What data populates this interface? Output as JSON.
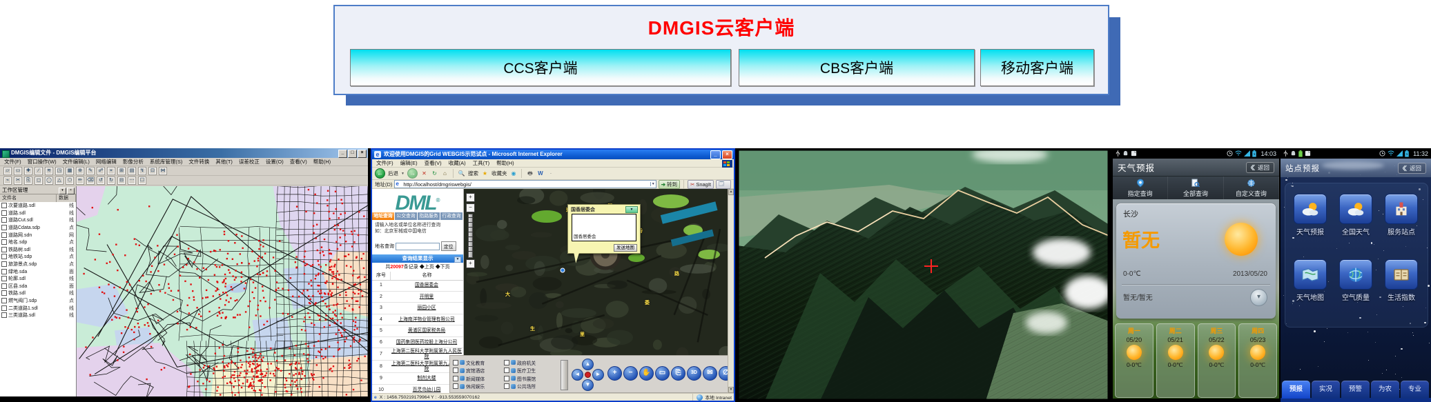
{
  "diagram": {
    "title": "DMGIS云客户端",
    "boxes": [
      {
        "label": "CCS客户端"
      },
      {
        "label": "CBS客户端"
      },
      {
        "label": "移动客户端"
      }
    ],
    "colors": {
      "border": "#4d7cc7",
      "shadow": "#3f6ab5",
      "title": "#ff0000",
      "box_gradient_top": "#00dff0"
    }
  },
  "gis": {
    "window_title": "DMGIS编辑文件 - DMGIS编辑平台",
    "menus": [
      "文件(F)",
      "窗口操作(W)",
      "文件编辑(L)",
      "网络编辑",
      "影像分析",
      "系统库管理(S)",
      "文件转换",
      "其他(T)",
      "误差校正",
      "设置(O)",
      "查看(V)",
      "帮助(H)"
    ],
    "panel_title": "工作区管理",
    "columns": [
      "文件名",
      "数据"
    ],
    "layers": [
      {
        "name": "次要道路.sdl",
        "type": "线"
      },
      {
        "name": "道路.sdl",
        "type": "线"
      },
      {
        "name": "道路Cut.sdl",
        "type": "线"
      },
      {
        "name": "道路Cdata.sdp",
        "type": "点"
      },
      {
        "name": "道路网.sdn",
        "type": "网"
      },
      {
        "name": "地名.sdp",
        "type": "点"
      },
      {
        "name": "铁路树.sdl",
        "type": "线"
      },
      {
        "name": "地铁站.sdp",
        "type": "点"
      },
      {
        "name": "旅游景点.sdp",
        "type": "点"
      },
      {
        "name": "绿地.sda",
        "type": "面"
      },
      {
        "name": "轮廓.sdl",
        "type": "线"
      },
      {
        "name": "区县.sda",
        "type": "面"
      },
      {
        "name": "铁路.sdl",
        "type": "线"
      },
      {
        "name": "燃气阀门.sdp",
        "type": "点"
      },
      {
        "name": "二类道路1.sdl",
        "type": "线"
      },
      {
        "name": "三类道路.sdl",
        "type": "线"
      }
    ]
  },
  "browser": {
    "window_title": "欢迎使用DMGIS的Grid WEBGIS示范试点 - Microsoft Internet Explorer",
    "menus": [
      "文件(F)",
      "编辑(E)",
      "查看(V)",
      "收藏(A)",
      "工具(T)",
      "帮助(H)"
    ],
    "toolbar": {
      "back": "后退",
      "search_label": "搜索",
      "favorites_label": "收藏夹"
    },
    "address": {
      "label": "地址(D)",
      "url": "http://localhost/dmgriswebgis/",
      "go": "转到",
      "snagit": "SnagIt"
    },
    "panel": {
      "logo": "DML",
      "tabs": [
        "地址查询",
        "公交查询",
        "指路服务",
        "行政查询"
      ],
      "hint_line1": "请输入地名或单位名称进行查询",
      "hint_line2": "如：北京军械或中国电信",
      "search_label": "地名查询",
      "locate_button": "定位",
      "results_title": "查询结果显示",
      "total_prefix": "共",
      "total_count": "20097",
      "total_suffix": "条记录",
      "page_prev": "◆上页",
      "page_next": "◆下页",
      "columns": [
        "序号",
        "名称"
      ],
      "rows": [
        {
          "no": "1",
          "name": "国香居委会"
        },
        {
          "no": "2",
          "name": "开明里"
        },
        {
          "no": "3",
          "name": "丽园小区"
        },
        {
          "no": "4",
          "name": "上海南洋物业管理有限公司"
        },
        {
          "no": "5",
          "name": "黄浦区国家税务局"
        },
        {
          "no": "6",
          "name": "国药集团医药控股上海分公司"
        },
        {
          "no": "7",
          "name": "上海第二医科大学附属第九人民医院"
        },
        {
          "no": "8",
          "name": "上海第二医科大学附属第九人民医院"
        },
        {
          "no": "9",
          "name": "制剂大楼"
        },
        {
          "no": "10",
          "name": "百灵鸟幼儿园"
        }
      ]
    },
    "popup": {
      "title": "国香居委会",
      "content": "国香居委会",
      "send_button": "发送地图"
    },
    "legend": [
      "文化教育",
      "政府机关",
      "宾馆酒店",
      "医疗卫生",
      "新闻媒体",
      "图书展馆",
      "休闲娱乐",
      "公共场所"
    ],
    "map_labels": [
      "球",
      "街",
      "香",
      "大",
      "生",
      "里",
      "委",
      "路"
    ],
    "map_buttons": [
      "+",
      "−",
      "✋",
      "▭",
      "⎘",
      "3D",
      "✉",
      "∅"
    ],
    "status_coords": "X : 1456.750219179964   Y : -913.553559070162",
    "status_zone": "本地 Intranet"
  },
  "phone_weather": {
    "time": "14:03",
    "title": "天气预报",
    "back_button": "返回",
    "tabs": [
      {
        "label": "指定查询"
      },
      {
        "label": "全部查询"
      },
      {
        "label": "自定义查询"
      }
    ],
    "card": {
      "city": "长沙",
      "condition": "暂无",
      "temp": "0-0℃",
      "date": "2013/05/20",
      "wind": "暂无/暂无"
    },
    "days": [
      {
        "day": "周一",
        "date": "05/20",
        "temp": "0-0℃"
      },
      {
        "day": "周二",
        "date": "05/21",
        "temp": "0-0℃"
      },
      {
        "day": "周三",
        "date": "05/22",
        "temp": "0-0℃"
      },
      {
        "day": "周四",
        "date": "05/23",
        "temp": "0-0℃"
      }
    ]
  },
  "phone_sites": {
    "time": "11:32",
    "title": "站点预报",
    "back_button": "返回",
    "apps": [
      "天气预报",
      "全国天气",
      "服务站点",
      "天气地图",
      "空气质量",
      "生活指数"
    ],
    "tabs": [
      "预报",
      "实况",
      "预警",
      "为农",
      "专业"
    ]
  },
  "colors": {
    "xp_blue": "#1c63e8",
    "win2k_blue": "#0a246a",
    "holo_blue": "#35b6e5",
    "accent_orange": "#f59a00",
    "red_dot": "#e01010"
  }
}
